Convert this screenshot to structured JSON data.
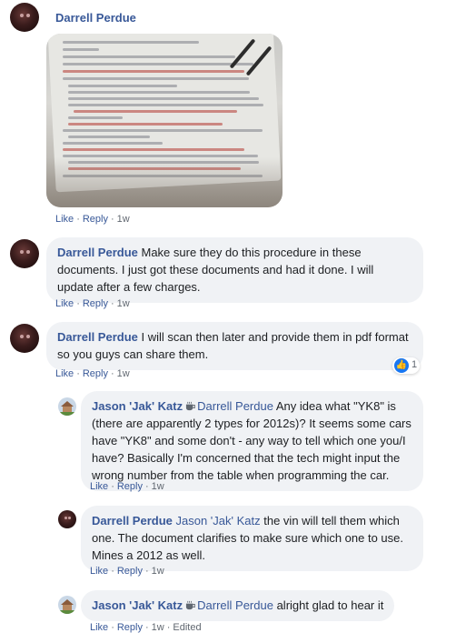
{
  "comments": [
    {
      "author": "Darrell Perdue",
      "text": "",
      "photo": {
        "page_text": [
          "The CAN Battery Main Capacity Learn process is to be performed with a scan tool using the following steps:",
          "1. Ignition ON",
          "2. With a scan tool, select Hybrid Powertrain Control Module 2 and Security and select the Hybrid/EV Battery Main Capacity Learn procedure.",
          "3. Select Hybrid Powertrain Control Module 2 Configuration Reset Functions. Select the Latch Function — Hybrid/EV Battery Main Capacity Learn",
          "Note: During the Latch-Up (HPCM 2 Configuration Reset function) the scan tool may loose communication...",
          "4. Using the Hybrid/EV Powertrain Control Module 2 to enter image mode by performing the following:",
          "4.1. Turn the ignition OFF",
          "4.2. Ensure the scan tool is not communicating with any control modules by returning to the Main Menu screen.",
          "4.3. Ensure the scan tool is accessible without having to open doors or otherwise cause vehicle wake-up.",
          "4.4. Wait 10 minutes. Do NOT disturb the hybrid battery or provide any vehicle control such as opening doors, take over, move vehicle, etc.",
          "Note: Please ensure no power provision is available before connecting the high voltage battery.",
          "4.5. Ignition ON",
          "4.6. With scan tool set to communicate with all control modules.",
          "5. With a scan tool verify the Hybrid/EV Powertrain Control Module 2 has gone to sleep by ensuring communication is not present.",
          "Repeat the previous step.",
          "If communication is not present",
          "6. Ignition ON. Reconnect ignition...",
          "7. With a scan tool reconnect to the Hybrid/EV Battery Main Capacity Learn procedure.",
          "Enter new kWh capacity values for the hybrid battery. This value is used to set the battery capacity value in the following table.",
          "Note: Please ensure data is entered correctly.",
          "8. Observe the Hybrid/EV Battery Capacity Learn process; allow the vehicle to complete the procedure."
        ]
      },
      "actions": {
        "like": "Like",
        "reply": "Reply",
        "time": "1w",
        "edited": ""
      }
    },
    {
      "author": "Darrell Perdue",
      "text": "Make sure they do this procedure in these documents. I just got these documents and had it done. I will update after a few charges.",
      "actions": {
        "like": "Like",
        "reply": "Reply",
        "time": "1w",
        "edited": ""
      }
    },
    {
      "author": "Darrell Perdue",
      "text": "I will scan then later and provide them in pdf format so you guys can share them.",
      "actions": {
        "like": "Like",
        "reply": "Reply",
        "time": "1w",
        "edited": ""
      },
      "reaction": {
        "icon": "thumbs-up-icon",
        "count": "1"
      }
    },
    {
      "author": "Jason 'Jak' Katz",
      "tag": "Darrell Perdue",
      "text": "Any idea what \"YK8\" is (there are apparently 2 types for 2012s)? It seems some cars have \"YK8\" and some don't - any way to tell which one you/I have? Basically I'm concerned that the tech might input the wrong number from the table when programming the car.",
      "badge_icon": "coffee-cup-icon",
      "actions": {
        "like": "Like",
        "reply": "Reply",
        "time": "1w",
        "edited": ""
      }
    },
    {
      "author": "Darrell Perdue",
      "tag": "Jason 'Jak' Katz",
      "text": "the vin will tell them which one. The document clarifies to make sure which one to use. Mines a 2012 as well.",
      "actions": {
        "like": "Like",
        "reply": "Reply",
        "time": "1w",
        "edited": ""
      }
    },
    {
      "author": "Jason 'Jak' Katz",
      "tag": "Darrell Perdue",
      "text": "alright glad to hear it",
      "badge_icon": "coffee-cup-icon",
      "actions": {
        "like": "Like",
        "reply": "Reply",
        "time": "1w",
        "edited": "Edited"
      }
    }
  ],
  "separator": "·",
  "colors": {
    "link": "#385898",
    "bubble": "#f0f2f5",
    "meta": "#606770",
    "like_blue": "#1877f2"
  }
}
